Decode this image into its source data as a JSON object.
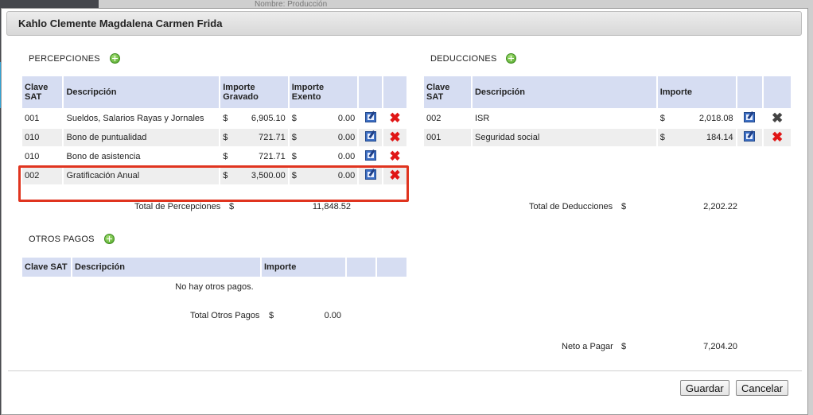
{
  "background": {
    "top_text": "Nombre:   Producción"
  },
  "modal": {
    "title": "Kahlo Clemente Magdalena Carmen Frida"
  },
  "percepciones": {
    "label": "PERCEPCIONES",
    "headers": {
      "clave": "Clave SAT",
      "descripcion": "Descripción",
      "gravado": "Importe Gravado",
      "exento": "Importe Exento"
    },
    "rows": [
      {
        "clave": "001",
        "descripcion": "Sueldos, Salarios Rayas y Jornales",
        "gravado": "6,905.10",
        "exento": "0.00"
      },
      {
        "clave": "010",
        "descripcion": "Bono de puntualidad",
        "gravado": "721.71",
        "exento": "0.00"
      },
      {
        "clave": "010",
        "descripcion": "Bono de asistencia",
        "gravado": "721.71",
        "exento": "0.00"
      },
      {
        "clave": "002",
        "descripcion": "Gratificación Anual",
        "gravado": "3,500.00",
        "exento": "0.00"
      }
    ],
    "currency": "$",
    "total_label": "Total de Percepciones",
    "total_value": "11,848.52"
  },
  "otros_pagos": {
    "label": "OTROS PAGOS",
    "headers": {
      "clave": "Clave SAT",
      "descripcion": "Descripción",
      "importe": "Importe"
    },
    "empty_message": "No hay otros pagos.",
    "total_label": "Total Otros Pagos",
    "total_value": "0.00"
  },
  "deducciones": {
    "label": "DEDUCCIONES",
    "headers": {
      "clave": "Clave SAT",
      "descripcion": "Descripción",
      "importe": "Importe"
    },
    "rows": [
      {
        "clave": "002",
        "descripcion": "ISR",
        "importe": "2,018.08"
      },
      {
        "clave": "001",
        "descripcion": "Seguridad social",
        "importe": "184.14"
      }
    ],
    "total_label": "Total de Deducciones",
    "total_value": "2,202.22"
  },
  "neto": {
    "label": "Neto a Pagar",
    "value": "7,204.20"
  },
  "buttons": {
    "guardar": "Guardar",
    "cancelar": "Cancelar"
  },
  "colors": {
    "header_bg": "#d6ddf2",
    "highlight": "#e0341f",
    "delete": "#e01616"
  }
}
